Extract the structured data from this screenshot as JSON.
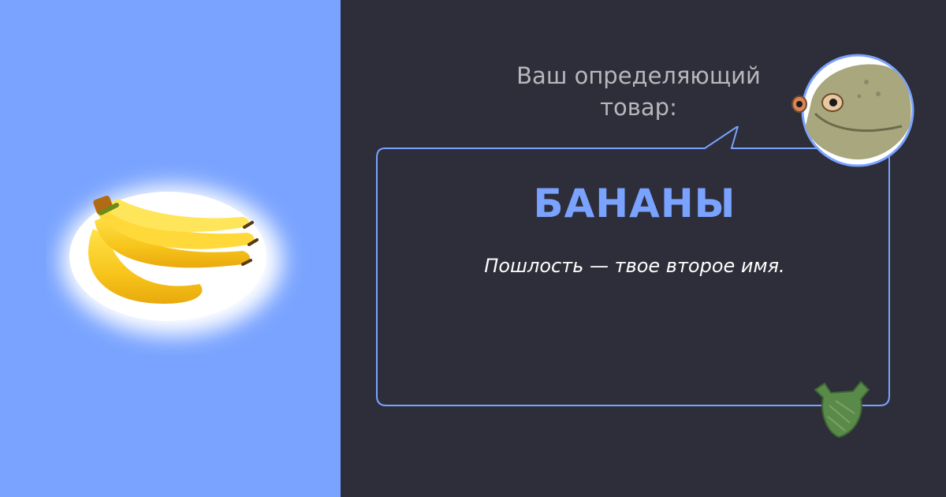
{
  "header": {
    "prompt": "Ваш определяющий\nтовар:"
  },
  "result": {
    "title": "БАНАНЫ",
    "description": "Пошлость — твое второе имя."
  },
  "images": {
    "product": "banana-bunch",
    "avatar": "frog-head",
    "decor": "plastic-bag-icon"
  },
  "colors": {
    "left_bg": "#79a3ff",
    "right_bg": "#2d2e39",
    "accent": "#7aa2ff",
    "bubble_border": "#7aa2ff",
    "prompt_text": "#b7b7bc",
    "description_text": "#ffffff"
  }
}
